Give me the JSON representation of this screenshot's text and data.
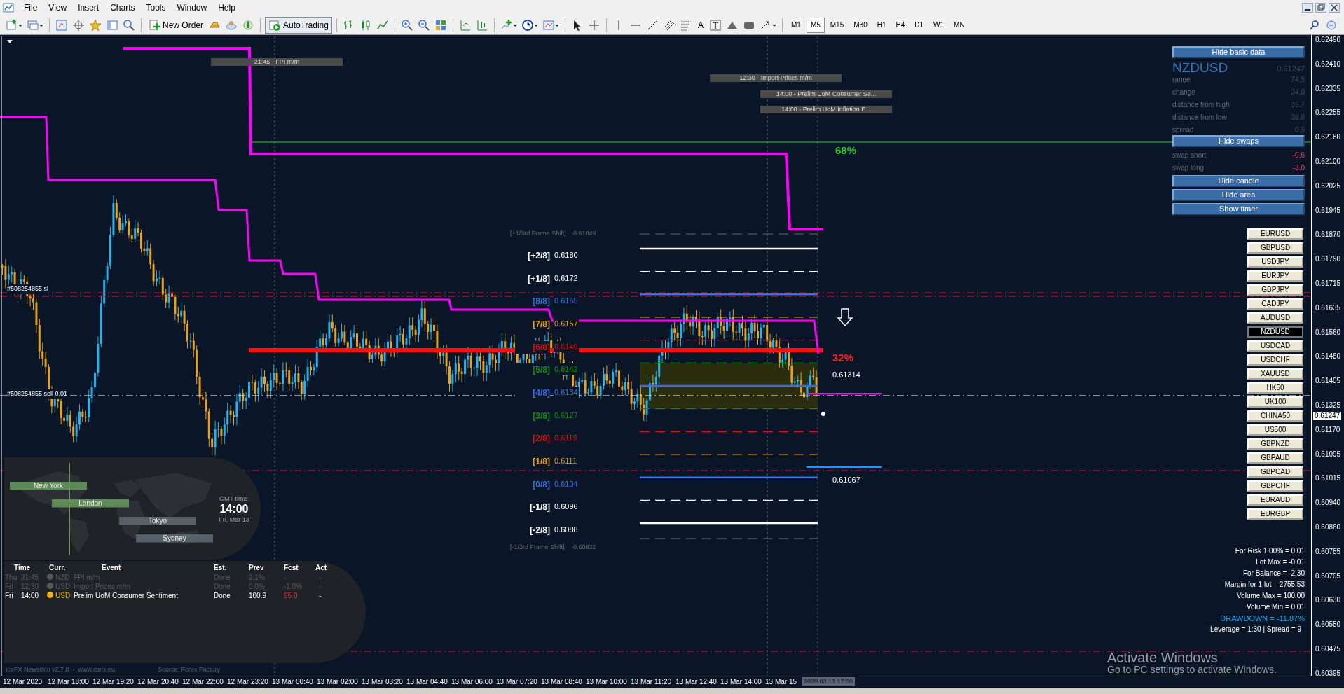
{
  "menu": [
    {
      "label": "File"
    },
    {
      "label": "View"
    },
    {
      "label": "Insert"
    },
    {
      "label": "Charts"
    },
    {
      "label": "Tools"
    },
    {
      "label": "Window"
    },
    {
      "label": "Help"
    }
  ],
  "toolbar": {
    "new_order": "New Order",
    "auto_trading": "AutoTrading",
    "text_tool": "A",
    "timeframes": [
      {
        "label": "M1",
        "selected": false
      },
      {
        "label": "M5",
        "selected": true
      },
      {
        "label": "M15",
        "selected": false
      },
      {
        "label": "M30",
        "selected": false
      },
      {
        "label": "H1",
        "selected": false
      },
      {
        "label": "H4",
        "selected": false
      },
      {
        "label": "D1",
        "selected": false
      },
      {
        "label": "W1",
        "selected": false
      },
      {
        "label": "MN",
        "selected": false
      }
    ]
  },
  "chart": {
    "price_axis": [
      "0.62490",
      "0.62410",
      "0.62335",
      "0.62255",
      "0.62180",
      "0.62100",
      "0.62025",
      "0.61945",
      "0.61870",
      "0.61790",
      "0.61715",
      "0.61635",
      "0.61560",
      "0.61480",
      "0.61405",
      "0.61325",
      "0.61170",
      "0.61095",
      "0.61015",
      "0.60940",
      "0.60860",
      "0.60785",
      "0.60705",
      "0.60630",
      "0.60550",
      "0.60475",
      "0.60395"
    ],
    "current_price": "0.61247",
    "time_axis": [
      "12 Mar 2020",
      "12 Mar 18:00",
      "12 Mar 19:20",
      "12 Mar 20:40",
      "12 Mar 22:00",
      "12 Mar 23:20",
      "13 Mar 00:40",
      "13 Mar 02:00",
      "13 Mar 03:20",
      "13 Mar 04:40",
      "13 Mar 06:00",
      "13 Mar 07:20",
      "13 Mar 08:40",
      "13 Mar 10:00",
      "13 Mar 11:20",
      "13 Mar 12:40",
      "13 Mar 14:00",
      "13 Mar 15"
    ],
    "cursor_time": "2020.03.13 17:00",
    "event_markers": [
      "21:45 - FPI m/m",
      "12:30 - Import Prices m/m",
      "14:00 - Prelim UoM Consumer Se...",
      "14:00 - Prelim UoM Inflation E..."
    ],
    "order_labels": [
      "#508254855 sl",
      "#508254855 sell 0.01"
    ],
    "frame_shift": [
      {
        "label": "[+1/3rd Frame Shift]",
        "value": "0.61849"
      },
      {
        "label": "[-1/3rd Frame Shift]",
        "value": "0.60832"
      }
    ],
    "levels": [
      {
        "label": "[+2/8]",
        "value": "0.6180",
        "color": "#ffffff",
        "kind": "solid"
      },
      {
        "label": "[+1/8]",
        "value": "0.6172",
        "color": "#ffffff",
        "kind": "dashed"
      },
      {
        "label": "[8/8]",
        "value": "0.6165",
        "color": "#3a6fe0",
        "kind": "solid"
      },
      {
        "label": "[7/8]",
        "value": "0.6157",
        "color": "#e0a020",
        "kind": "dashed"
      },
      {
        "label": "[6/8]",
        "value": "0.6149",
        "color": "#e01010",
        "kind": "dashed"
      },
      {
        "label": "[5/8]",
        "value": "0.6142",
        "color": "#109010",
        "kind": "dashed"
      },
      {
        "label": "[4/8]",
        "value": "0.6134",
        "color": "#3a6fe0",
        "kind": "solid"
      },
      {
        "label": "[3/8]",
        "value": "0.6127",
        "color": "#109010",
        "kind": "dashed"
      },
      {
        "label": "[2/8]",
        "value": "0.6119",
        "color": "#e01010",
        "kind": "dashed"
      },
      {
        "label": "[1/8]",
        "value": "0.6111",
        "color": "#e0a020",
        "kind": "dashed"
      },
      {
        "label": "[0/8]",
        "value": "0.6104",
        "color": "#3a6fe0",
        "kind": "solid"
      },
      {
        "label": "[-1/8]",
        "value": "0.6096",
        "color": "#ffffff",
        "kind": "dashed"
      },
      {
        "label": "[-2/8]",
        "value": "0.6088",
        "color": "#ffffff",
        "kind": "solid"
      }
    ],
    "percent_up": "68%",
    "percent_down": "32%",
    "price_marks": [
      "0.61314",
      "0.61067"
    ]
  },
  "info_panel": {
    "hide_basic": "Hide basic data",
    "symbol": "NZDUSD",
    "price": "0.61247",
    "rows": [
      {
        "label": "range",
        "value": "74.5"
      },
      {
        "label": "change",
        "value": "34.0"
      },
      {
        "label": "distance from high",
        "value": "35.7"
      },
      {
        "label": "distance from low",
        "value": "38.8"
      },
      {
        "label": "spread",
        "value": "0.9"
      }
    ],
    "hide_swaps": "Hide swaps",
    "swaps": [
      {
        "label": "swap short",
        "value": "-0.6"
      },
      {
        "label": "swap long",
        "value": "-3.0"
      }
    ],
    "buttons": [
      "Hide candle",
      "Hide area",
      "Show timer"
    ]
  },
  "symbols": [
    {
      "label": "EURUSD",
      "selected": false
    },
    {
      "label": "GBPUSD",
      "selected": false
    },
    {
      "label": "USDJPY",
      "selected": false
    },
    {
      "label": "EURJPY",
      "selected": false
    },
    {
      "label": "GBPJPY",
      "selected": false
    },
    {
      "label": "CADJPY",
      "selected": false
    },
    {
      "label": "AUDUSD",
      "selected": false
    },
    {
      "label": "NZDUSD",
      "selected": true
    },
    {
      "label": "USDCAD",
      "selected": false
    },
    {
      "label": "USDCHF",
      "selected": false
    },
    {
      "label": "XAUUSD",
      "selected": false
    },
    {
      "label": "HK50",
      "selected": false
    },
    {
      "label": "UK100",
      "selected": false
    },
    {
      "label": "CHINA50",
      "selected": false
    },
    {
      "label": "US500",
      "selected": false
    },
    {
      "label": "GBPNZD",
      "selected": false
    },
    {
      "label": "GBPAUD",
      "selected": false
    },
    {
      "label": "GBPCAD",
      "selected": false
    },
    {
      "label": "GBPCHF",
      "selected": false
    },
    {
      "label": "EURAUD",
      "selected": false
    },
    {
      "label": "EURGBP",
      "selected": false
    }
  ],
  "risk": [
    {
      "text": "For Risk 1.00% = 0.01",
      "kind": "plain"
    },
    {
      "text": "Lot Max = -0.01",
      "kind": "plain"
    },
    {
      "text": "For Balance = -2.30",
      "kind": "plain"
    },
    {
      "text": "Margin for 1 lot = 2755.53",
      "kind": "plain"
    },
    {
      "text": "Volume Max = 100.00",
      "kind": "plain"
    },
    {
      "text": "Volume Min = 0.01",
      "kind": "plain"
    },
    {
      "text": "DRAWDOWN = -11.87%",
      "kind": "alert"
    },
    {
      "text": "Leverage = 1:30 | Spread = 9",
      "kind": "plain"
    }
  ],
  "sessions": {
    "gmt_label": "GMT time:",
    "time": "14:00",
    "date": "Fri, Mar 13",
    "markets": [
      {
        "name": "New York",
        "active": true
      },
      {
        "name": "London",
        "active": true
      },
      {
        "name": "Tokyo",
        "active": false
      },
      {
        "name": "Sydney",
        "active": false
      }
    ]
  },
  "news": {
    "columns": [
      "Time",
      "Curr.",
      "Event",
      "Est.",
      "Prev",
      "Fcst",
      "Act"
    ],
    "rows": [
      {
        "day": "Thu",
        "time": "21:45",
        "currency": "NZD",
        "event": "FPI m/m",
        "est": "Done",
        "prev": "2.1%",
        "fcst": "-",
        "act": "-",
        "past": true
      },
      {
        "day": "Fri",
        "time": "12:30",
        "currency": "USD",
        "event": "Import Prices m/m",
        "est": "Done",
        "prev": "0.0%",
        "fcst": "-1.0%",
        "act": "-",
        "past": true
      },
      {
        "day": "Fri",
        "time": "14:00",
        "currency": "USD",
        "event": "Prelim UoM Consumer Sentiment",
        "est": "Done",
        "prev": "100.9",
        "fcst": "95.0",
        "act": "-",
        "past": false
      }
    ],
    "footer": "IceFX NewsInfo v2.7.0  -  www.icefx.eu",
    "source": "Source: Forex Factory"
  },
  "os_notice": {
    "title": "Activate Windows",
    "text": "Go to PC settings to activate Windows."
  }
}
